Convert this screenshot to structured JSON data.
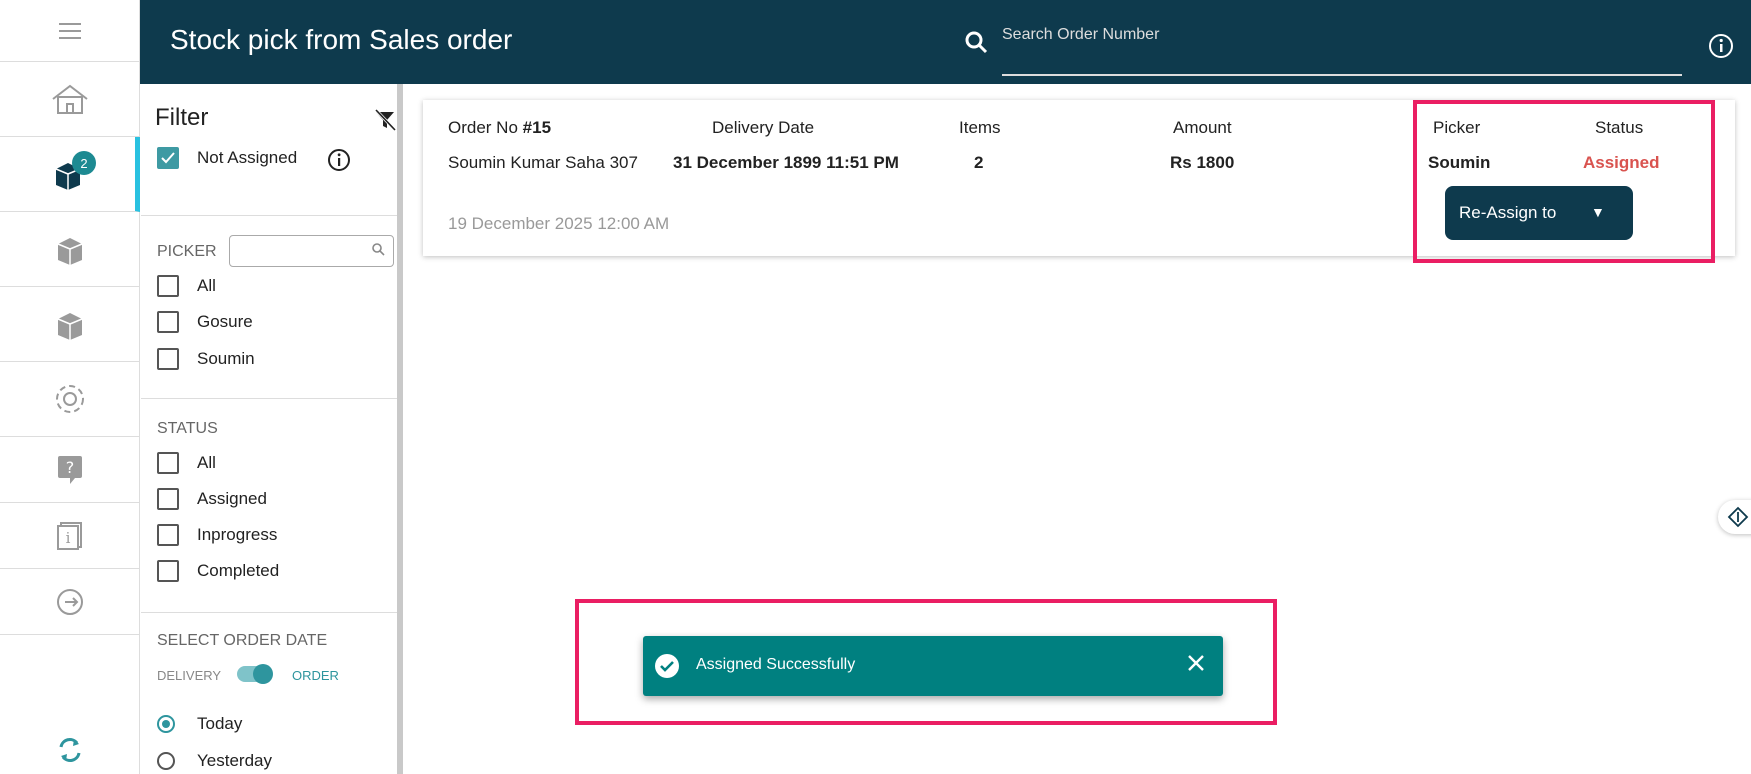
{
  "header": {
    "title": "Stock pick from Sales order",
    "search_placeholder": "Search Order Number"
  },
  "rail": {
    "badge_count": "2"
  },
  "filter": {
    "title": "Filter",
    "not_assigned_label": "Not Assigned",
    "not_assigned_checked": true,
    "picker_section": "PICKER",
    "picker_options": [
      "All",
      "Gosure",
      "Soumin"
    ],
    "status_section": "STATUS",
    "status_options": [
      "All",
      "Assigned",
      "Inprogress",
      "Completed"
    ],
    "date_section": "SELECT ORDER DATE",
    "toggle_left": "DELIVERY",
    "toggle_right": "ORDER",
    "date_options": [
      "Today",
      "Yesterday"
    ],
    "date_selected": "Today"
  },
  "order": {
    "order_no_label": "Order No",
    "order_no_value": "#15",
    "customer": "Soumin Kumar Saha 307",
    "created": "19 December 2025 12:00 AM",
    "delivery_label": "Delivery Date",
    "delivery_value": "31 December 1899 11:51 PM",
    "items_label": "Items",
    "items_value": "2",
    "amount_label": "Amount",
    "amount_value": "Rs 1800",
    "picker_label": "Picker",
    "picker_value": "Soumin",
    "status_label": "Status",
    "status_value": "Assigned",
    "reassign_label": "Re-Assign to",
    "reassign_caret": "▼"
  },
  "toast": {
    "message": "Assigned Successfully"
  },
  "colors": {
    "header": "#0e3a4d",
    "accent": "#29c1e0",
    "toast": "#008080",
    "highlight": "#ea1e63",
    "status_assigned": "#d9534f"
  }
}
